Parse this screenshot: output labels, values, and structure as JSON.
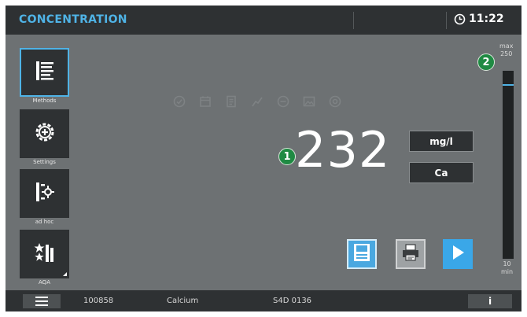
{
  "header": {
    "title": "CONCENTRATION",
    "time": "11:22"
  },
  "sidebar": {
    "items": [
      {
        "label": "Methods",
        "icon": "methods-list-icon",
        "active": true
      },
      {
        "label": "Settings",
        "icon": "settings-gear-icon",
        "active": false
      },
      {
        "label": "ad hoc",
        "icon": "adhoc-target-icon",
        "active": false
      },
      {
        "label": "AQA",
        "icon": "aqa-stars-icon",
        "active": false
      }
    ]
  },
  "toolbar_icons": [
    "check-icon",
    "calendar-icon",
    "document-icon",
    "chart-icon",
    "minus-circle-icon",
    "image-icon",
    "target-icon"
  ],
  "badges": {
    "result": "1",
    "range": "2"
  },
  "result": {
    "value": "232",
    "unit": "mg/l",
    "form": "Ca"
  },
  "gauge": {
    "max_label": "max",
    "max_value": "250",
    "min_value": "10",
    "min_label": "min",
    "min": 10,
    "max": 250,
    "current": 232
  },
  "actions": {
    "save_icon": "save-icon",
    "print_icon": "print-icon",
    "start_icon": "play-icon"
  },
  "footer": {
    "menu_icon": "menu-icon",
    "method_number": "100858",
    "parameter": "Calcium",
    "instrument_id": "S4D 0136",
    "info_label": "i"
  },
  "colors": {
    "accent": "#4fb3e6",
    "badge": "#1f8a43",
    "panel": "#6d7173",
    "bar": "#2e3133"
  }
}
